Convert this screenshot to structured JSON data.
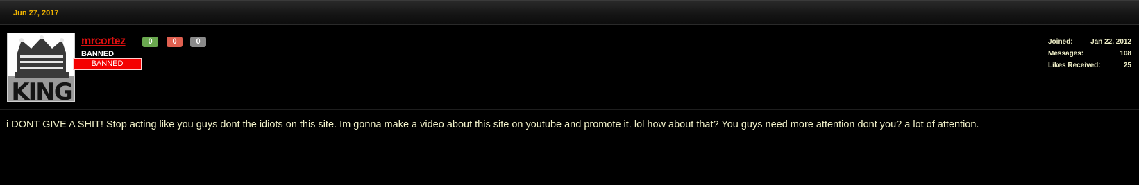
{
  "post": {
    "date": "Jun 27, 2017",
    "message": "i DONT GIVE A SHIT! Stop acting like you guys dont the idiots on this site. Im gonna make a video about this site on youtube and promote it. lol how about that? You guys need more attention dont you? a lot of attention."
  },
  "user": {
    "name": "mrcortez",
    "title": "BANNED",
    "banner": "BANNED",
    "avatar_text": "KING",
    "scores": [
      {
        "value": "0",
        "color": "#6aa84f"
      },
      {
        "value": "0",
        "color": "#e06050"
      },
      {
        "value": "0",
        "color": "#8a8a8a"
      }
    ],
    "stats": {
      "joined_label": "Joined:",
      "joined_value": "Jan 22, 2012",
      "messages_label": "Messages:",
      "messages_value": "108",
      "likes_label": "Likes Received:",
      "likes_value": "25"
    }
  },
  "colors": {
    "background": "#000000",
    "date": "#f0b400",
    "username": "#e01010",
    "banner": "#f40000",
    "text": "#f0f0c8"
  }
}
